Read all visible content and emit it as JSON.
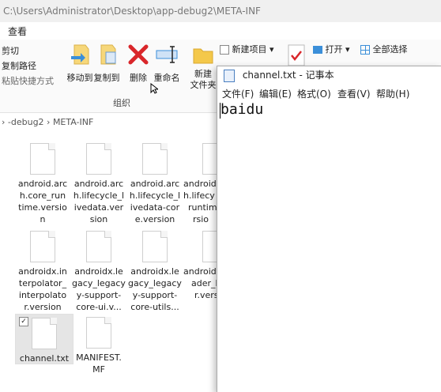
{
  "explorer": {
    "title_path": "C:\\Users\\Administrator\\Desktop\\app-debug2\\META-INF",
    "menu_tab": "查看",
    "ribbon": {
      "cut": "剪切",
      "copy_path": "复制路径",
      "paste_shortcut": "粘贴快捷方式",
      "move_to": "移动到",
      "copy_to": "复制到",
      "delete": "删除",
      "rename": "重命名",
      "new_folder_line1": "新建",
      "new_folder_line2": "文件夹",
      "new_item": "新建项目",
      "open": "打开",
      "select_all": "全部选择",
      "group_label": "组织"
    },
    "address": "› -debug2  ›  META-INF",
    "files": [
      "android.arch.core_runtime.version",
      "android.arch.lifecycle_livedata.version",
      "android.arch.lifecycle_livedata-core.version",
      "android.arch.lifecycle_runtime.version",
      "androidx.interpolator_interpolator.version",
      "androidx.legacy_legacy-support-core-ui.v...",
      "androidx.legacy_legacy-support-core-utils...",
      "androidx.loader_loader.version",
      "channel.txt",
      "MANIFEST.MF"
    ],
    "file_labels": [
      [
        "android.arc",
        "h.core_run",
        "time.versio",
        "n"
      ],
      [
        "android.arc",
        "h.lifecycle_l",
        "ivedata.ver",
        "sion"
      ],
      [
        "android.arc",
        "h.lifecycle_l",
        "ivedata-cor",
        "e.version"
      ],
      [
        "android.arc",
        "h.lifecy",
        "runtim",
        "rsio"
      ],
      [
        "androidx.in",
        "terpolator_",
        "interpolato",
        "r.version"
      ],
      [
        "androidx.le",
        "gacy_legacy",
        "y-support-",
        "core-ui.v..."
      ],
      [
        "androidx.le",
        "gacy_legacy",
        "y-support-",
        "core-utils..."
      ],
      [
        "androidx.lo",
        "ader_lo",
        "r.vers",
        ""
      ],
      [
        "channel.txt"
      ],
      [
        "MANIFEST.",
        "MF"
      ]
    ]
  },
  "notepad": {
    "title": "channel.txt - 记事本",
    "menu": [
      "文件(F)",
      "编辑(E)",
      "格式(O)",
      "查看(V)",
      "帮助(H)"
    ],
    "content": "baidu"
  },
  "colors": {
    "accent_blue": "#3b8fd9",
    "delete_red": "#d9262a",
    "folder_yellow": "#f4c84a"
  }
}
